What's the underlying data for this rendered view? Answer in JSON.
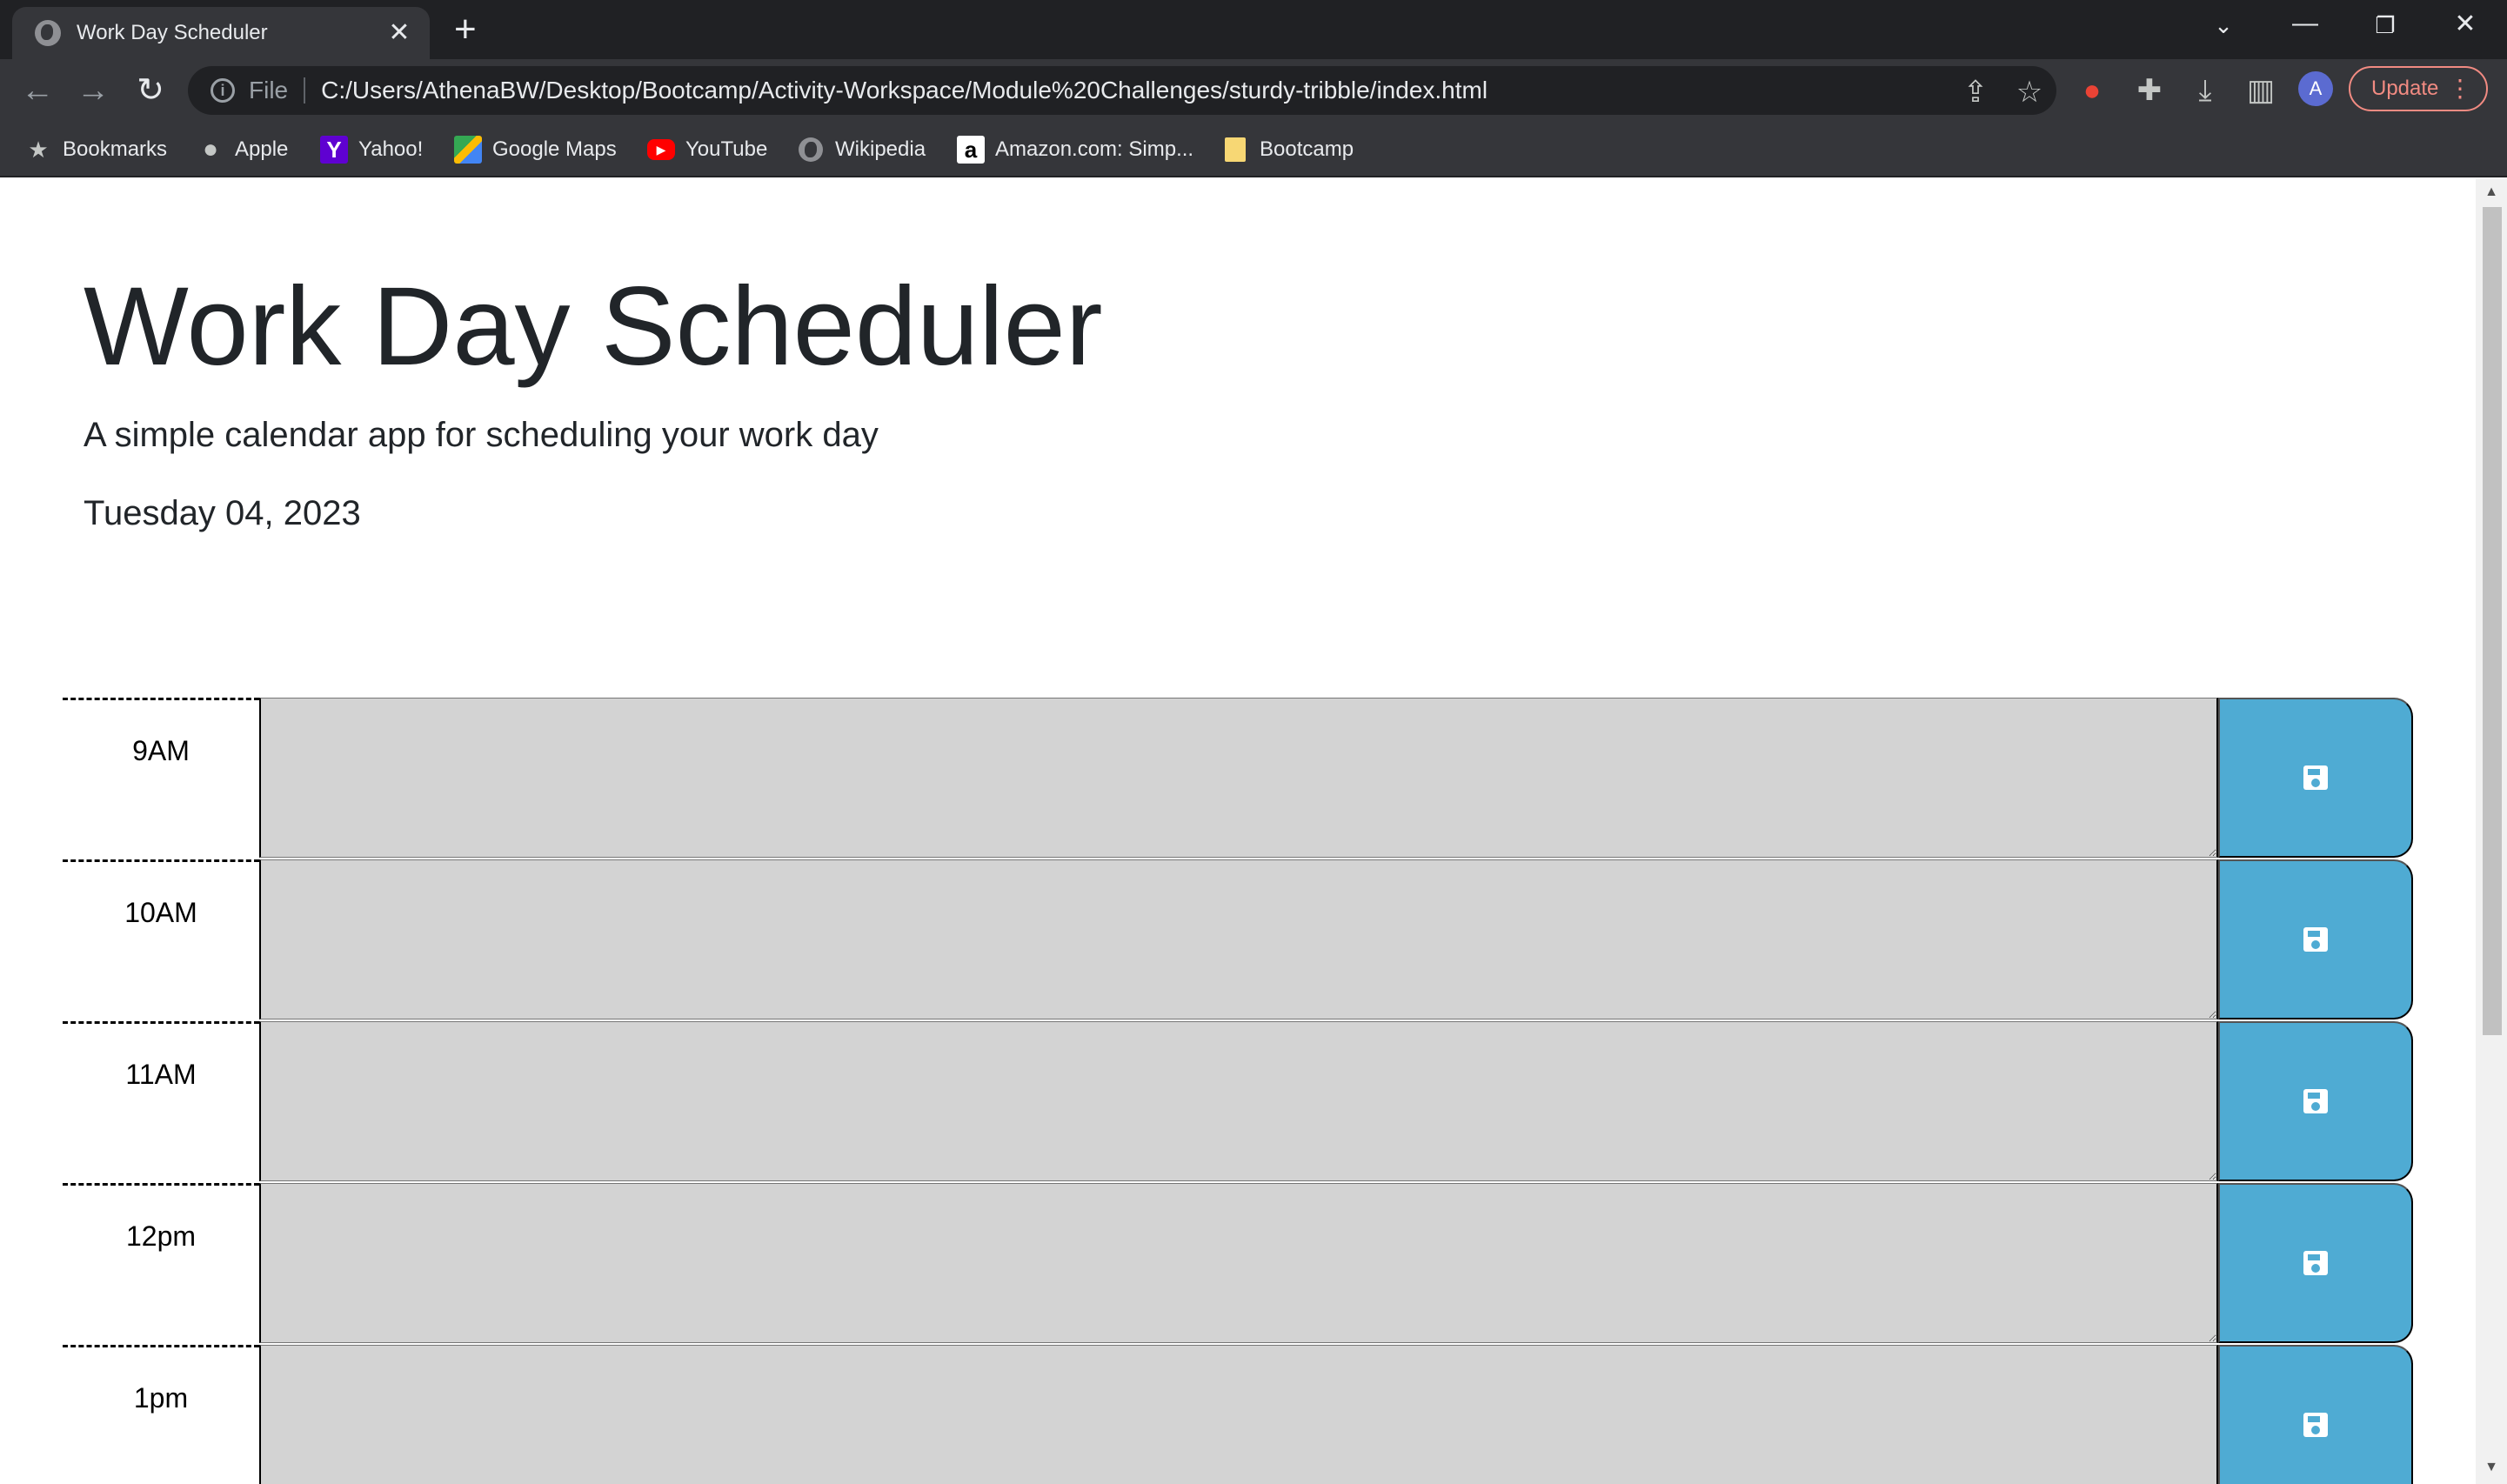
{
  "browser": {
    "tab_title": "Work Day Scheduler",
    "file_label": "File",
    "url": "C:/Users/AthenaBW/Desktop/Bootcamp/Activity-Workspace/Module%20Challenges/sturdy-tribble/index.html",
    "avatar_letter": "A",
    "update_label": "Update",
    "bookmarks": [
      {
        "label": "Bookmarks",
        "icon": "star-icon"
      },
      {
        "label": "Apple",
        "icon": "apple-icon"
      },
      {
        "label": "Yahoo!",
        "icon": "yahoo-icon"
      },
      {
        "label": "Google Maps",
        "icon": "google-maps-icon"
      },
      {
        "label": "YouTube",
        "icon": "youtube-icon"
      },
      {
        "label": "Wikipedia",
        "icon": "globe-icon"
      },
      {
        "label": "Amazon.com: Simp...",
        "icon": "amazon-icon"
      },
      {
        "label": "Bootcamp",
        "icon": "folder-icon"
      }
    ]
  },
  "header": {
    "title": "Work Day Scheduler",
    "lead": "A simple calendar app for scheduling your work day",
    "current_day": "Tuesday 04, 2023"
  },
  "time_blocks": [
    {
      "hour": "9AM"
    },
    {
      "hour": "10AM"
    },
    {
      "hour": "11AM"
    },
    {
      "hour": "12pm"
    },
    {
      "hour": "1pm"
    }
  ],
  "colors": {
    "block_background": "#d3d3d3",
    "save_button": "#4fabd3",
    "chrome_dark": "#202124",
    "chrome_toolbar": "#35363a"
  }
}
